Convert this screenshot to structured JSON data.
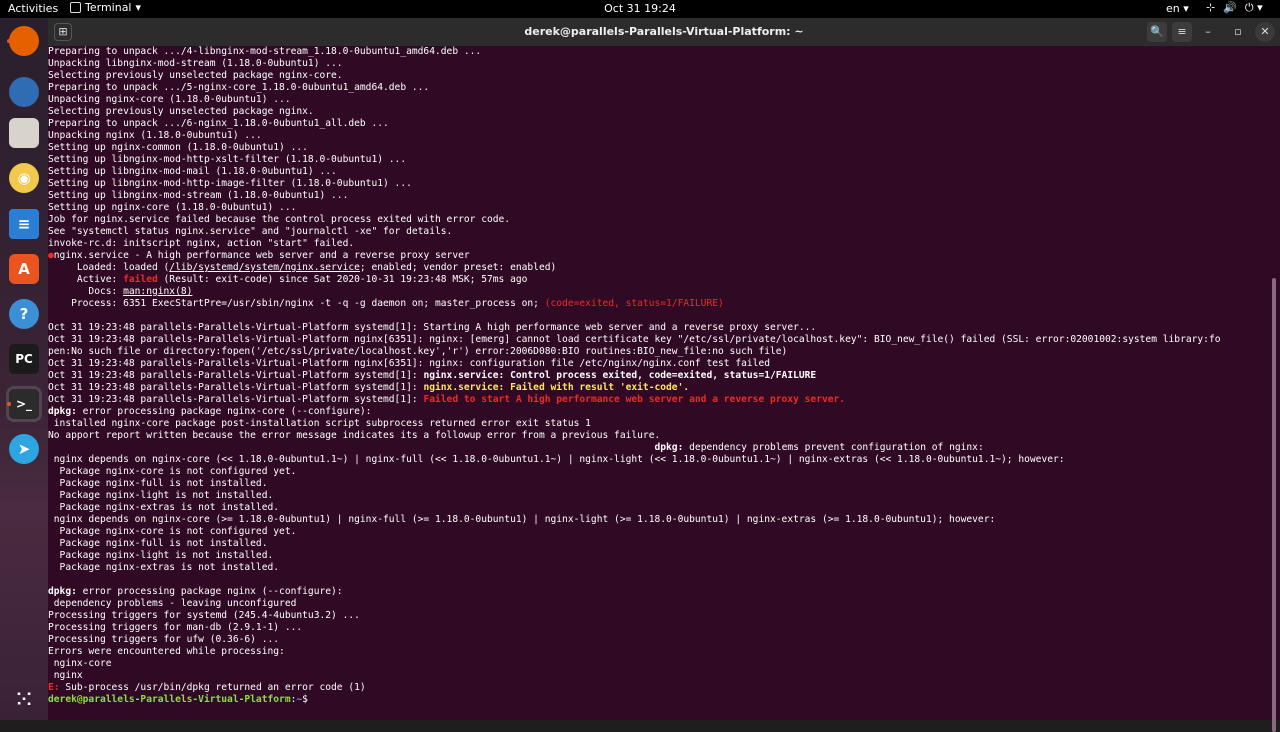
{
  "topbar": {
    "activities": "Activities",
    "app_name": "Terminal",
    "app_menu_caret": "▾",
    "clock": "Oct 31  19:24",
    "language": "en ▾",
    "tray": [
      "⊹",
      "🔊",
      "⏻ ▾"
    ]
  },
  "dock": {
    "items": [
      {
        "name": "firefox",
        "glyph": "",
        "color": "#e66000"
      },
      {
        "name": "thunderbird",
        "glyph": "",
        "color": "#2f6cb3"
      },
      {
        "name": "files",
        "glyph": "",
        "color": "#d8d3cc"
      },
      {
        "name": "rhythmbox",
        "glyph": "◉",
        "color": "#f2c94c"
      },
      {
        "name": "libreoffice-writer",
        "glyph": "≡",
        "color": "#2a7fd4"
      },
      {
        "name": "software",
        "glyph": "A",
        "color": "#e95420"
      },
      {
        "name": "help",
        "glyph": "?",
        "color": "#3b8fd6"
      },
      {
        "name": "pycharm",
        "glyph": "PC",
        "color": "#1b1b1b"
      },
      {
        "name": "terminal",
        "glyph": ">_",
        "color": "#2b2b2b"
      },
      {
        "name": "telegram",
        "glyph": "➤",
        "color": "#2ca5e0"
      }
    ],
    "apps_grid": "⁙"
  },
  "window": {
    "title": "derek@parallels-Parallels-Virtual-Platform: ~",
    "new_tab": "⊞",
    "search": "🔍",
    "menu": "≡",
    "minimize": "–",
    "maximize": "▫",
    "close": "✕"
  },
  "colors": {
    "terminal_bg": "#300a24",
    "prompt_green": "#8ae234",
    "path_blue": "#729fcf",
    "error_red": "#ef2929"
  },
  "terminal": {
    "lines": [
      [
        {
          "t": "Preparing to unpack .../4-libnginx-mod-stream_1.18.0-0ubuntu1_amd64.deb ..."
        }
      ],
      [
        {
          "t": "Unpacking libnginx-mod-stream (1.18.0-0ubuntu1) ..."
        }
      ],
      [
        {
          "t": "Selecting previously unselected package nginx-core."
        }
      ],
      [
        {
          "t": "Preparing to unpack .../5-nginx-core_1.18.0-0ubuntu1_amd64.deb ..."
        }
      ],
      [
        {
          "t": "Unpacking nginx-core (1.18.0-0ubuntu1) ..."
        }
      ],
      [
        {
          "t": "Selecting previously unselected package nginx."
        }
      ],
      [
        {
          "t": "Preparing to unpack .../6-nginx_1.18.0-0ubuntu1_all.deb ..."
        }
      ],
      [
        {
          "t": "Unpacking nginx (1.18.0-0ubuntu1) ..."
        }
      ],
      [
        {
          "t": "Setting up nginx-common (1.18.0-0ubuntu1) ..."
        }
      ],
      [
        {
          "t": "Setting up libnginx-mod-http-xslt-filter (1.18.0-0ubuntu1) ..."
        }
      ],
      [
        {
          "t": "Setting up libnginx-mod-mail (1.18.0-0ubuntu1) ..."
        }
      ],
      [
        {
          "t": "Setting up libnginx-mod-http-image-filter (1.18.0-0ubuntu1) ..."
        }
      ],
      [
        {
          "t": "Setting up libnginx-mod-stream (1.18.0-0ubuntu1) ..."
        }
      ],
      [
        {
          "t": "Setting up nginx-core (1.18.0-0ubuntu1) ..."
        }
      ],
      [
        {
          "t": "Job for nginx.service failed because the control process exited with error code."
        }
      ],
      [
        {
          "t": "See \"systemctl status nginx.service\" and \"journalctl -xe\" for details."
        }
      ],
      [
        {
          "t": "invoke-rc.d: initscript nginx, action \"start\" failed."
        }
      ],
      [
        {
          "t": "●",
          "c": "reddot"
        },
        {
          "t": "nginx.service - A high performance web server and a reverse proxy server"
        }
      ],
      [
        {
          "t": "     Loaded: loaded ("
        },
        {
          "t": "/lib/systemd/system/nginx.service",
          "c": "ul"
        },
        {
          "t": "; enabled; vendor preset: enabled)"
        }
      ],
      [
        {
          "t": "     Active: "
        },
        {
          "t": "failed",
          "c": "redb"
        },
        {
          "t": " (Result: exit-code) since Sat 2020-10-31 19:23:48 MSK; 57ms ago"
        }
      ],
      [
        {
          "t": "       Docs: "
        },
        {
          "t": "man:nginx(8)",
          "c": "ul"
        }
      ],
      [
        {
          "t": "    Process: 6351 ExecStartPre=/usr/sbin/nginx -t -q -g daemon on; master_process on; "
        },
        {
          "t": "(code=exited, status=1/FAILURE)",
          "c": "red"
        }
      ],
      [
        {
          "t": ""
        }
      ],
      [
        {
          "t": "Oct 31 19:23:48 parallels-Parallels-Virtual-Platform systemd[1]: Starting A high performance web server and a reverse proxy server..."
        }
      ],
      [
        {
          "t": "Oct 31 19:23:48 parallels-Parallels-Virtual-Platform nginx[6351]: nginx: [emerg] cannot load certificate key \"/etc/ssl/private/localhost.key\": BIO_new_file() failed (SSL: error:02001002:system library:fo"
        }
      ],
      [
        {
          "t": "pen:No such file or directory:fopen('/etc/ssl/private/localhost.key','r') error:2006D080:BIO routines:BIO_new_file:no such file)"
        }
      ],
      [
        {
          "t": "Oct 31 19:23:48 parallels-Parallels-Virtual-Platform nginx[6351]: nginx: configuration file /etc/nginx/nginx.conf test failed"
        }
      ],
      [
        {
          "t": "Oct 31 19:23:48 parallels-Parallels-Virtual-Platform systemd[1]: "
        },
        {
          "t": "nginx.service: Control process exited, code=exited, status=1/FAILURE",
          "c": "bold"
        }
      ],
      [
        {
          "t": "Oct 31 19:23:48 parallels-Parallels-Virtual-Platform systemd[1]: "
        },
        {
          "t": "nginx.service: Failed with result 'exit-code'.",
          "c": "yellowb"
        }
      ],
      [
        {
          "t": "Oct 31 19:23:48 parallels-Parallels-Virtual-Platform systemd[1]: "
        },
        {
          "t": "Failed to start A high performance web server and a reverse proxy server.",
          "c": "redb"
        }
      ],
      [
        {
          "t": "dpkg:",
          "c": "bold"
        },
        {
          "t": " error processing package nginx-core (--configure):"
        }
      ],
      [
        {
          "t": " installed nginx-core package post-installation script subprocess returned error exit status 1"
        }
      ],
      [
        {
          "t": "No apport report written because the error message indicates its a followup error from a previous failure."
        }
      ],
      [
        {
          "t": "                                                                                                         "
        },
        {
          "t": "dpkg:",
          "c": "bold"
        },
        {
          "t": " dependency problems prevent configuration of nginx:"
        }
      ],
      [
        {
          "t": " nginx depends on nginx-core (<< 1.18.0-0ubuntu1.1~) | nginx-full (<< 1.18.0-0ubuntu1.1~) | nginx-light (<< 1.18.0-0ubuntu1.1~) | nginx-extras (<< 1.18.0-0ubuntu1.1~); however:"
        }
      ],
      [
        {
          "t": "  Package nginx-core is not configured yet."
        }
      ],
      [
        {
          "t": "  Package nginx-full is not installed."
        }
      ],
      [
        {
          "t": "  Package nginx-light is not installed."
        }
      ],
      [
        {
          "t": "  Package nginx-extras is not installed."
        }
      ],
      [
        {
          "t": " nginx depends on nginx-core (>= 1.18.0-0ubuntu1) | nginx-full (>= 1.18.0-0ubuntu1) | nginx-light (>= 1.18.0-0ubuntu1) | nginx-extras (>= 1.18.0-0ubuntu1); however:"
        }
      ],
      [
        {
          "t": "  Package nginx-core is not configured yet."
        }
      ],
      [
        {
          "t": "  Package nginx-full is not installed."
        }
      ],
      [
        {
          "t": "  Package nginx-light is not installed."
        }
      ],
      [
        {
          "t": "  Package nginx-extras is not installed."
        }
      ],
      [
        {
          "t": ""
        }
      ],
      [
        {
          "t": "dpkg:",
          "c": "bold"
        },
        {
          "t": " error processing package nginx (--configure):"
        }
      ],
      [
        {
          "t": " dependency problems - leaving unconfigured"
        }
      ],
      [
        {
          "t": "Processing triggers for systemd (245.4-4ubuntu3.2) ..."
        }
      ],
      [
        {
          "t": "Processing triggers for man-db (2.9.1-1) ..."
        }
      ],
      [
        {
          "t": "Processing triggers for ufw (0.36-6) ..."
        }
      ],
      [
        {
          "t": "Errors were encountered while processing:"
        }
      ],
      [
        {
          "t": " nginx-core"
        }
      ],
      [
        {
          "t": " nginx"
        }
      ],
      [
        {
          "t": "E:",
          "c": "redb"
        },
        {
          "t": " Sub-process /usr/bin/dpkg returned an error code (1)"
        }
      ],
      [
        {
          "t": "derek@parallels-Parallels-Virtual-Platform",
          "c": "green"
        },
        {
          "t": ":"
        },
        {
          "t": "~",
          "c": "blue"
        },
        {
          "t": "$ "
        }
      ]
    ]
  }
}
